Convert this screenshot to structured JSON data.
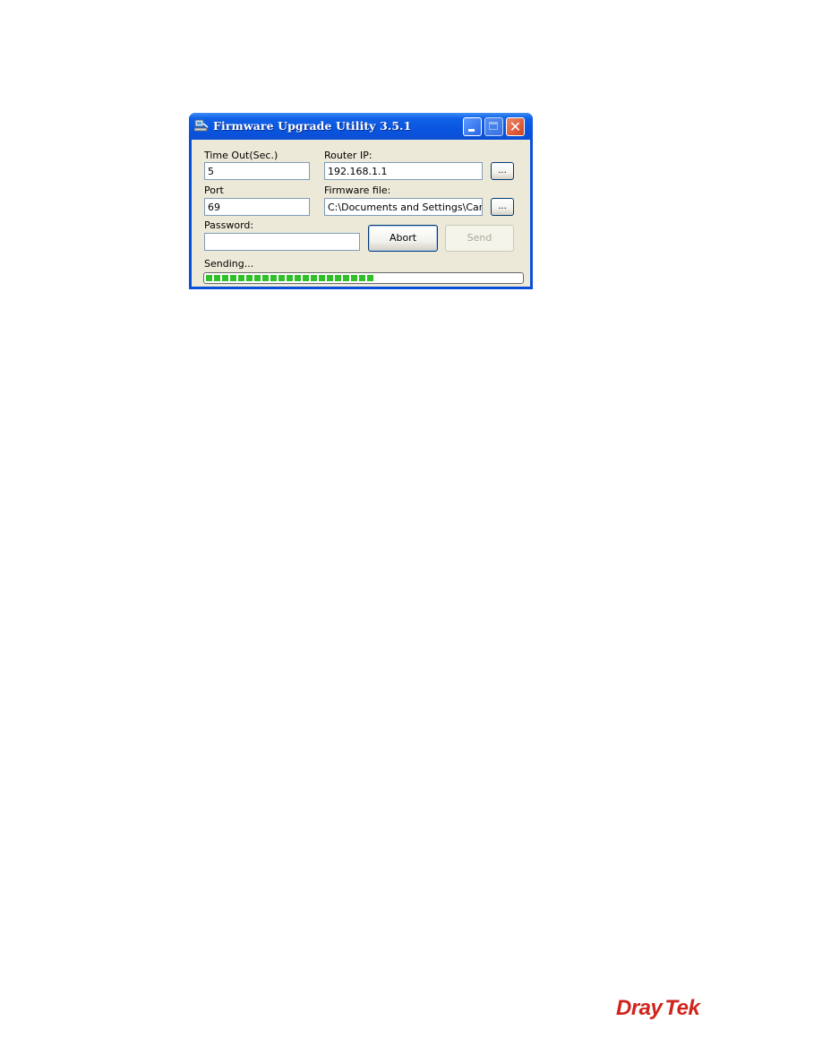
{
  "window": {
    "title": "Firmware Upgrade Utility 3.5.1",
    "title_icon": "network-computer-icon",
    "controls": {
      "minimize": "minimize-icon",
      "maximize": "maximize-icon",
      "maximize_enabled": false,
      "close": "close-icon"
    }
  },
  "form": {
    "timeout_label": "Time Out(Sec.)",
    "timeout_value": "5",
    "port_label": "Port",
    "port_value": "69",
    "password_label": "Password:",
    "password_value": "",
    "router_ip_label": "Router IP:",
    "router_ip_value": "192.168.1.1",
    "router_ip_browse": "...",
    "firmware_label": "Firmware file:",
    "firmware_value": "C:\\Documents and Settings\\Carrie",
    "firmware_browse": "..."
  },
  "buttons": {
    "abort": "Abort",
    "send": "Send",
    "send_enabled": false
  },
  "status": {
    "text": "Sending...",
    "progress_percent": 53,
    "progress_color": "#2fc02a"
  },
  "logo": {
    "part1": "Dray",
    "part2": "Tek",
    "color": "#d0231c"
  }
}
